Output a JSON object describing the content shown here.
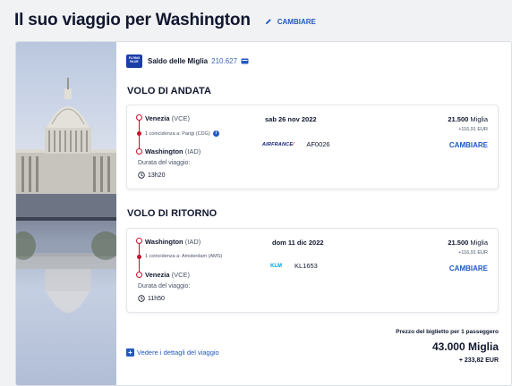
{
  "header": {
    "title": "Il suo viaggio per Washington",
    "change_label": "CAMBIARE"
  },
  "miles_balance": {
    "logo_text": "FLYING BLUE",
    "label": "Saldo delle Miglia",
    "value": "210.627"
  },
  "outbound": {
    "section_title": "VOLO DI ANDATA",
    "origin_city": "Venezia",
    "origin_code": "(VCE)",
    "connection": "1 coincidenza a: Parigi (CDG)",
    "destination_city": "Washington",
    "destination_code": "(IAD)",
    "duration_label": "Durata del viaggio:",
    "duration": "13h20",
    "date": "sab 26 nov 2022",
    "airline_name": "AIRFRANCE",
    "flight_number": "AF0026",
    "miles": "21.500",
    "miles_unit": "Miglia",
    "eur": "+116,91 EUR",
    "change_label": "CAMBIARE"
  },
  "return": {
    "section_title": "VOLO DI RITORNO",
    "origin_city": "Washington",
    "origin_code": "(IAD)",
    "connection": "1 coincidenza a: Amsterdam (AMS)",
    "destination_city": "Venezia",
    "destination_code": "(VCE)",
    "duration_label": "Durata del viaggio:",
    "duration": "11h50",
    "date": "dom 11 dic 2022",
    "airline_name": "KLM",
    "flight_number": "KL1653",
    "miles": "21.500",
    "miles_unit": "Miglia",
    "eur": "+116,91 EUR",
    "change_label": "CAMBIARE"
  },
  "details_link": "Vedere i dettagli del viaggio",
  "total": {
    "label": "Prezzo del biglietto per 1 passeggero",
    "miles": "43.000",
    "miles_unit": "Miglia",
    "eur": "+ 233,82 EUR"
  },
  "colors": {
    "accent": "#2158c2",
    "route": "#c8102e",
    "text": "#10172e"
  }
}
